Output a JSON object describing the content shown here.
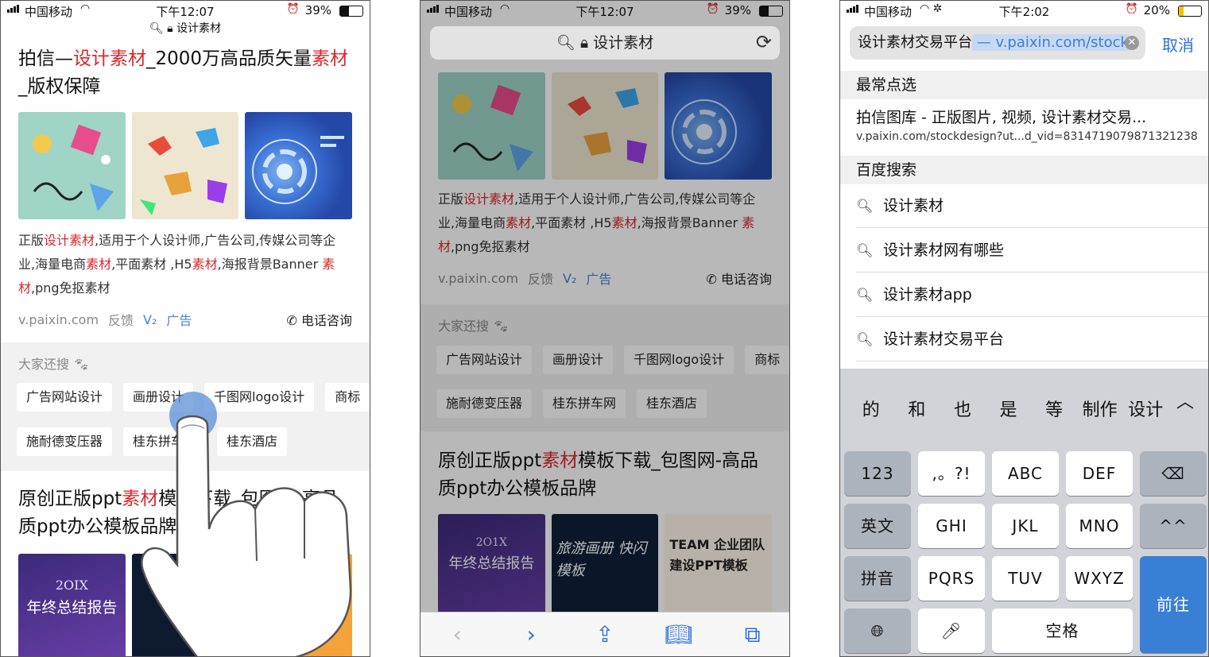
{
  "panel1": {
    "status": {
      "carrier": "中国移动",
      "time": "下午12:07",
      "battery": "39%",
      "battery_level": 0.39
    },
    "url_label": "设计素材",
    "result1": {
      "title_parts": [
        {
          "t": "拍信—",
          "red": false
        },
        {
          "t": "设计素材",
          "red": true
        },
        {
          "t": "_2000万高品质矢量",
          "red": false
        },
        {
          "t": "素材",
          "red": true
        },
        {
          "t": "_版权保障",
          "red": false
        }
      ],
      "desc_parts": [
        {
          "t": "正版",
          "red": false
        },
        {
          "t": "设计素材",
          "red": true
        },
        {
          "t": ",适用于个人设计师,广告公司,传媒公司等企业,海量电商",
          "red": false
        },
        {
          "t": "素材",
          "red": true
        },
        {
          "t": ",平面素材 ,H5",
          "red": false
        },
        {
          "t": "素材",
          "red": true
        },
        {
          "t": ",海报背景Banner ",
          "red": false
        },
        {
          "t": "素材",
          "red": true
        },
        {
          "t": ",png免抠素材",
          "red": false
        }
      ],
      "domain": "v.paixin.com",
      "feedback": "反馈",
      "badge": "V₂",
      "ad": "广告",
      "call": "电话咨询"
    },
    "also_label": "大家还搜",
    "chips_row1": [
      "广告网站设计",
      "画册设计",
      "千图网logo设计",
      "商标"
    ],
    "chips_row2": [
      "施耐德变压器",
      "桂东拼车网",
      "桂东酒店"
    ],
    "result2": {
      "title_parts": [
        {
          "t": "原创正版ppt",
          "red": false
        },
        {
          "t": "素材",
          "red": true
        },
        {
          "t": "模板下载_包图网-高品质ppt办公模板品牌",
          "red": false
        }
      ],
      "thumb_text": "年终总结报告",
      "thumb_year": "2OIX"
    }
  },
  "panel2": {
    "status": {
      "carrier": "中国移动",
      "time": "下午12:07",
      "battery": "39%",
      "battery_level": 0.39
    },
    "search_label": "设计素材",
    "desc_parts": [
      {
        "t": "正版",
        "red": false
      },
      {
        "t": "设计素材",
        "red": true
      },
      {
        "t": ",适用于个人设计师,广告公司,传媒公司等企业,海量电商",
        "red": false
      },
      {
        "t": "素材",
        "red": true
      },
      {
        "t": ",平面素材 ,H5",
        "red": false
      },
      {
        "t": "素材",
        "red": true
      },
      {
        "t": ",海报背景Banner ",
        "red": false
      },
      {
        "t": "素材",
        "red": true
      },
      {
        "t": ",png免抠素材",
        "red": false
      }
    ],
    "domain": "v.paixin.com",
    "feedback": "反馈",
    "badge": "V₂",
    "ad": "广告",
    "call": "电话咨询",
    "also_label": "大家还搜",
    "chips_row1": [
      "广告网站设计",
      "画册设计",
      "千图网logo设计",
      "商标"
    ],
    "chips_row2": [
      "施耐德变压器",
      "桂东拼车网",
      "桂东酒店"
    ],
    "result2_title_parts": [
      {
        "t": "原创正版ppt",
        "red": false
      },
      {
        "t": "素材",
        "red": true
      },
      {
        "t": "模板下载_包图网-高品质ppt办公模板品牌",
        "red": false
      }
    ],
    "thumbs": [
      "年终总结报告",
      "旅游画册 快闪模板",
      "TEAM 企业团队建设PPT模板"
    ],
    "thumb_year": "2O1X"
  },
  "panel3": {
    "status": {
      "carrier": "中国移动",
      "time": "下午2:02",
      "battery": "20%",
      "battery_level": 0.2
    },
    "search_text": "设计素材交易平台",
    "search_suggest": " — v.paixin.com/stock",
    "cancel": "取消",
    "top_hits_label": "最常点选",
    "top_hit_title": "拍信图库 - 正版图片, 视频, 设计素材交易...",
    "top_hit_url": "v.paixin.com/stockdesign?ut...d_vid=8314719079871321238",
    "baidu_label": "百度搜索",
    "suggestions": [
      "设计素材",
      "设计素材网有哪些",
      "设计素材app",
      "设计素材交易平台"
    ],
    "candidates": [
      "的",
      "和",
      "也",
      "是",
      "等",
      "制作",
      "设计"
    ],
    "keys": {
      "row1": [
        "123",
        ",。?!",
        "ABC",
        "DEF"
      ],
      "row2": [
        "英文",
        "GHI",
        "JKL",
        "MNO",
        "^^"
      ],
      "row3": [
        "拼音",
        "PQRS",
        "TUV",
        "WXYZ"
      ],
      "space": "空格",
      "go": "前往"
    }
  }
}
